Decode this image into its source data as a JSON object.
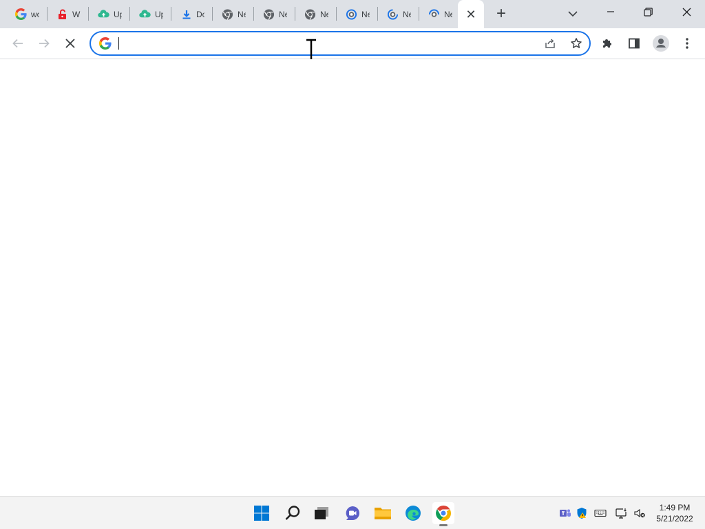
{
  "browser": {
    "tabs": [
      {
        "title": "wc",
        "favicon": "google-icon"
      },
      {
        "title": "W",
        "favicon": "unlock-icon"
      },
      {
        "title": "Up",
        "favicon": "cloud-upload-icon"
      },
      {
        "title": "Up",
        "favicon": "cloud-upload-icon"
      },
      {
        "title": "Do",
        "favicon": "download-icon"
      },
      {
        "title": "Ne",
        "favicon": "chrome-icon"
      },
      {
        "title": "Ne",
        "favicon": "chrome-icon"
      },
      {
        "title": "Ne",
        "favicon": "chrome-icon"
      },
      {
        "title": "Ne",
        "favicon": "loading-icon"
      },
      {
        "title": "Ne",
        "favicon": "loading-icon"
      },
      {
        "title": "Ne",
        "favicon": "loading-icon"
      }
    ],
    "active_tab_close": "✕",
    "new_tab": "+",
    "omnibox": {
      "value": "",
      "placeholder": ""
    },
    "accent": "#1a73e8"
  },
  "taskbar": {
    "apps": [
      "windows-start-icon",
      "search-icon",
      "task-view-icon",
      "chat-icon",
      "file-explorer-icon",
      "edge-icon",
      "chrome-icon"
    ],
    "clock": {
      "time": "1:49 PM",
      "date": "5/21/2022"
    }
  }
}
